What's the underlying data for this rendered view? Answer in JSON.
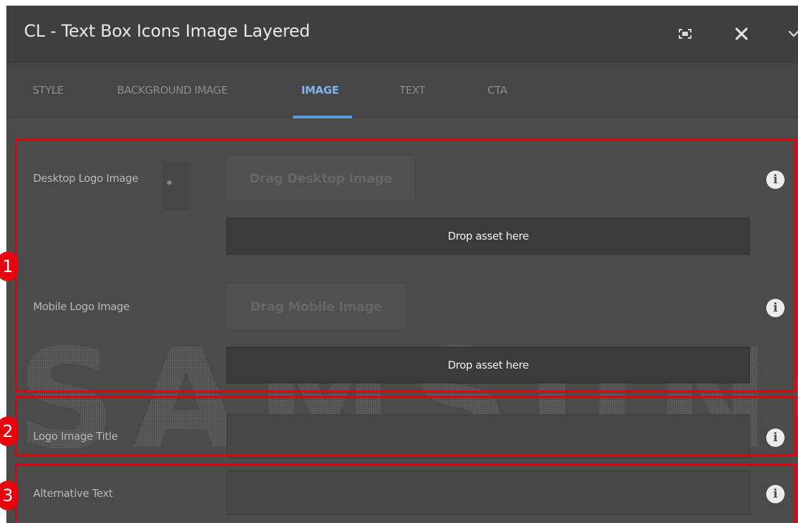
{
  "dialog": {
    "title": "CL - Text Box Icons Image Layered",
    "icons": {
      "fullscreen": "fullscreen-icon",
      "close": "close-icon",
      "more": "chevron-down-icon"
    }
  },
  "tabs": [
    {
      "label": "STYLE",
      "active": false
    },
    {
      "label": "BACKGROUND IMAGE",
      "active": false
    },
    {
      "label": "IMAGE",
      "active": true
    },
    {
      "label": "TEXT",
      "active": false
    },
    {
      "label": "CTA",
      "active": false
    }
  ],
  "fields": {
    "desktop_logo": {
      "label": "Desktop Logo Image",
      "required_mark": "*",
      "drag_label": "Drag Desktop Image",
      "drop_label": "Drop asset here",
      "info_icon": "i"
    },
    "mobile_logo": {
      "label": "Mobile Logo Image",
      "drag_label": "Drag Mobile Image",
      "drop_label": "Drop asset here",
      "info_icon": "i"
    },
    "logo_title": {
      "label": "Logo Image Title",
      "value": "",
      "info_icon": "i"
    },
    "alt_text": {
      "label": "Alternative Text",
      "value": "",
      "info_icon": "i"
    }
  },
  "watermark": "SAMSUNG",
  "annotations": {
    "badge_1": "1",
    "badge_2": "2",
    "badge_3": "3",
    "color": "#e2000f"
  },
  "colors": {
    "accent": "#5b9bde",
    "panel_bg": "#4b4b4b",
    "header_bg": "#3f3f3f"
  }
}
